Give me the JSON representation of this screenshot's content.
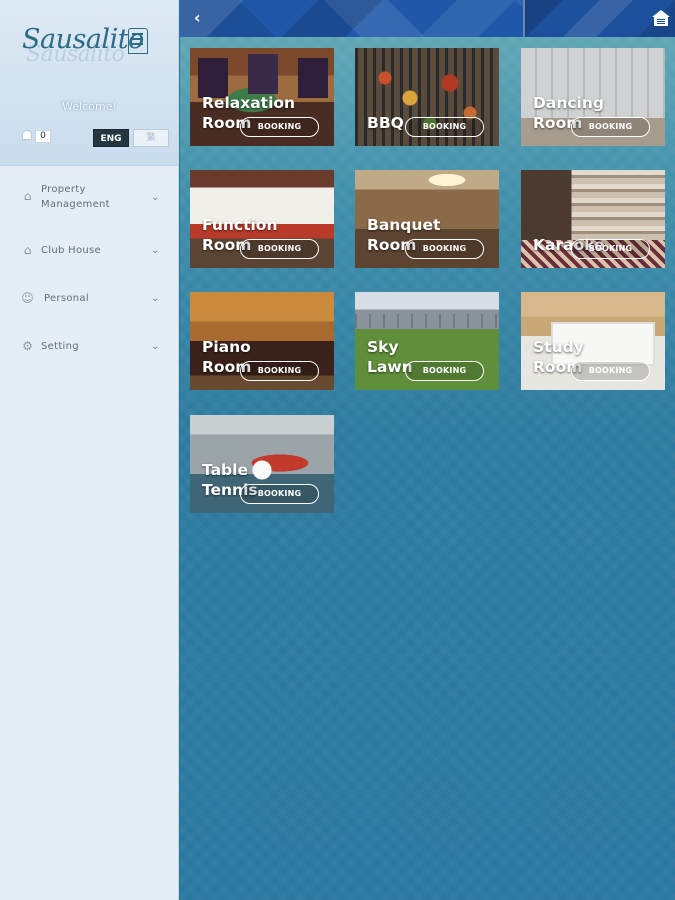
{
  "sidebar": {
    "logo_text": "Sausalito",
    "welcome": "Welcome!",
    "notification_count": "0",
    "lang_active": "ENG",
    "lang_inactive": "繁",
    "menu": [
      {
        "label": "Property Management",
        "icon": "property-icon"
      },
      {
        "label": "Club House",
        "icon": "clubhouse-icon"
      },
      {
        "label": "Personal",
        "icon": "person-icon"
      },
      {
        "label": "Setting",
        "icon": "gear-icon"
      }
    ]
  },
  "topbar": {
    "back_icon": "chevron-left-icon",
    "home_icon": "home-icon",
    "accent": "#1f58a9"
  },
  "facilities": [
    {
      "title": "Relaxation Room",
      "booking": "BOOKING"
    },
    {
      "title": "BBQ",
      "booking": "BOOKING"
    },
    {
      "title": "Dancing Room",
      "booking": "BOOKING"
    },
    {
      "title": "Function Room",
      "booking": "BOOKING"
    },
    {
      "title": "Banquet Room",
      "booking": "BOOKING"
    },
    {
      "title": "Karaoke",
      "booking": "BOOKING"
    },
    {
      "title": "Piano Room",
      "booking": "BOOKING"
    },
    {
      "title": "Sky Lawn",
      "booking": "BOOKING"
    },
    {
      "title": "Study Room",
      "booking": "BOOKING"
    },
    {
      "title": "Table Tennis",
      "booking": "BOOKING"
    }
  ]
}
